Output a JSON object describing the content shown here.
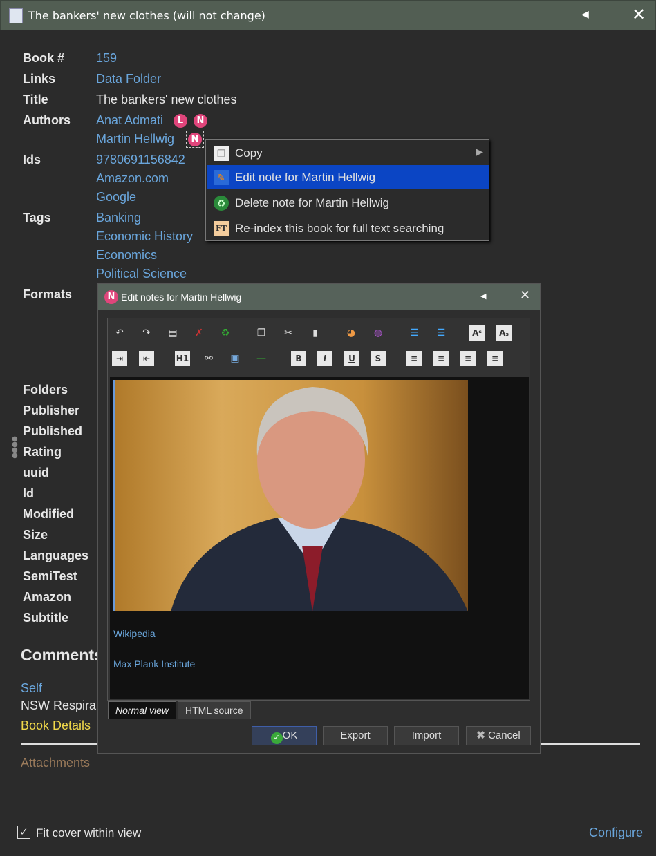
{
  "window": {
    "title": "The bankers' new clothes (will not change)"
  },
  "fields": {
    "book_num": {
      "label": "Book #",
      "value": "159"
    },
    "links": {
      "label": "Links",
      "value": "Data Folder"
    },
    "title": {
      "label": "Title",
      "value": "The bankers' new clothes"
    },
    "authors": {
      "label": "Authors",
      "values": [
        "Anat Admati",
        "Martin Hellwig"
      ],
      "badges": [
        "L",
        "N",
        "N"
      ]
    },
    "ids": {
      "label": "Ids",
      "values": [
        "9780691156842",
        "Amazon.com",
        "Google"
      ]
    },
    "tags": {
      "label": "Tags",
      "values": [
        "Banking",
        "Economic History",
        "Economics",
        "Political Science"
      ]
    },
    "formats": {
      "label": "Formats"
    },
    "rest": [
      "Folders",
      "Publisher",
      "Published",
      "Rating",
      "uuid",
      "Id",
      "Modified",
      "Size",
      "Languages",
      "SemiTest",
      "Amazon",
      "Subtitle"
    ]
  },
  "comments": {
    "heading": "Comments",
    "self": "Self",
    "nsw": "NSW Respira",
    "book_details": "Book Details",
    "attachments": "Attachments"
  },
  "footer": {
    "fit_cover": "Fit cover within view",
    "fit_cover_checked": true,
    "configure": "Configure"
  },
  "context_menu": {
    "items": [
      "Copy",
      "Edit note for Martin Hellwig",
      "Delete note for Martin Hellwig",
      "Re-index this book for full text searching"
    ],
    "ft_icon": "FT"
  },
  "dialog": {
    "badge": "N",
    "title": "Edit notes for Martin Hellwig",
    "toolbar_row1": [
      "undo-icon",
      "redo-icon",
      "select-all-icon",
      "clear-icon",
      "recycle-icon",
      "copy-icon",
      "cut-icon",
      "paste-icon",
      "background-color-icon",
      "foreground-color-icon",
      "ordered-list-icon",
      "unordered-list-icon",
      "superscript-icon",
      "subscript-icon"
    ],
    "toolbar_row2": [
      "indent-icon",
      "outdent-icon",
      "heading-icon",
      "link-icon",
      "image-icon",
      "horizontal-rule-icon",
      "bold-icon",
      "italic-icon",
      "underline-icon",
      "strikethrough-icon",
      "align-left-icon",
      "align-center-icon",
      "align-right-icon",
      "justify-icon"
    ],
    "links": [
      "Wikipedia",
      "Max Plank Institute"
    ],
    "tabs": [
      "Normal view",
      "HTML source"
    ],
    "buttons": {
      "ok": "OK",
      "export": "Export",
      "import": "Import",
      "cancel": "Cancel"
    }
  }
}
